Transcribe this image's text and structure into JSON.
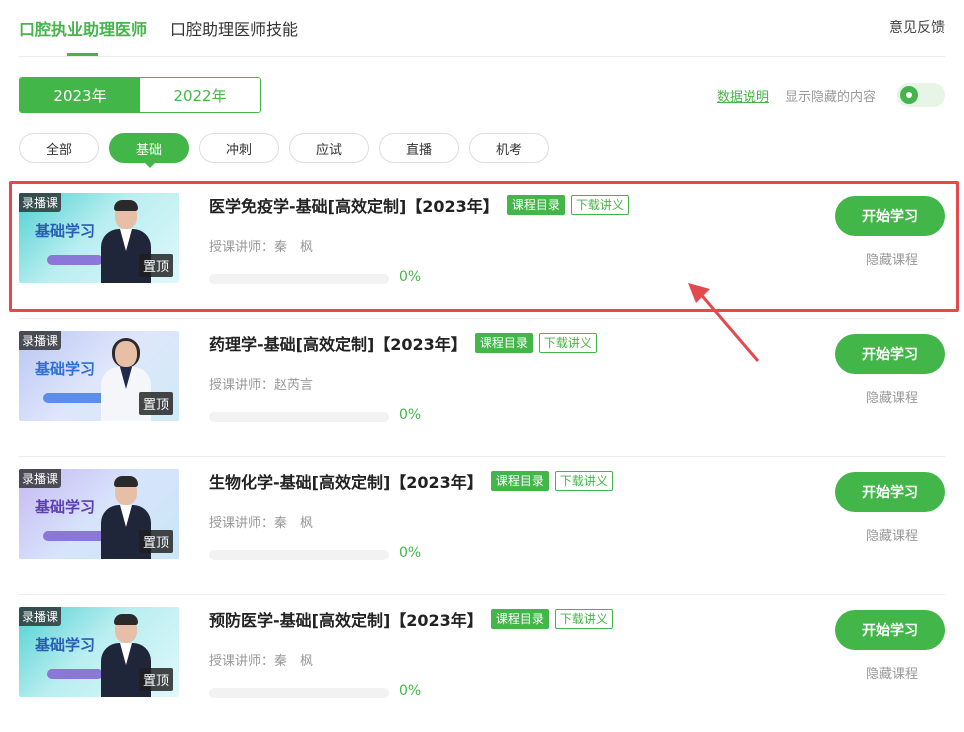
{
  "header": {
    "tabs": [
      {
        "label": "口腔执业助理医师"
      },
      {
        "label": "口腔助理医师技能"
      }
    ],
    "feedback": "意见反馈"
  },
  "years": [
    {
      "label": "2023年"
    },
    {
      "label": "2022年"
    }
  ],
  "controls": {
    "data_note": "数据说明",
    "show_hidden": "显示隐藏的内容",
    "show_hidden_on": true
  },
  "filters": [
    {
      "label": "全部"
    },
    {
      "label": "基础"
    },
    {
      "label": "冲刺"
    },
    {
      "label": "应试"
    },
    {
      "label": "直播"
    },
    {
      "label": "机考"
    }
  ],
  "courses": [
    {
      "title": "医学免疫学-基础[高效定制]【2023年】",
      "tag_catalog": "课程目录",
      "tag_download": "下载讲义",
      "teacher_label": "授课讲师：",
      "teacher": "秦　枫",
      "progress": 0,
      "progress_text": "0%",
      "start": "开始学习",
      "hide": "隐藏课程",
      "badge": "录播课",
      "pin": "置顶",
      "thumb_title": "基础学习"
    },
    {
      "title": "药理学-基础[高效定制]【2023年】",
      "tag_catalog": "课程目录",
      "tag_download": "下载讲义",
      "teacher_label": "授课讲师：",
      "teacher": "赵芮言",
      "progress": 0,
      "progress_text": "0%",
      "start": "开始学习",
      "hide": "隐藏课程",
      "badge": "录播课",
      "pin": "置顶",
      "thumb_title": "基础学习"
    },
    {
      "title": "生物化学-基础[高效定制]【2023年】",
      "tag_catalog": "课程目录",
      "tag_download": "下载讲义",
      "teacher_label": "授课讲师：",
      "teacher": "秦　枫",
      "progress": 0,
      "progress_text": "0%",
      "start": "开始学习",
      "hide": "隐藏课程",
      "badge": "录播课",
      "pin": "置顶",
      "thumb_title": "基础学习"
    },
    {
      "title": "预防医学-基础[高效定制]【2023年】",
      "tag_catalog": "课程目录",
      "tag_download": "下载讲义",
      "teacher_label": "授课讲师：",
      "teacher": "秦　枫",
      "progress": 0,
      "progress_text": "0%",
      "start": "开始学习",
      "hide": "隐藏课程",
      "badge": "录播课",
      "pin": "置顶",
      "thumb_title": "基础学习"
    }
  ],
  "colors": {
    "accent": "#43b649",
    "highlight": "#e34a4e"
  }
}
